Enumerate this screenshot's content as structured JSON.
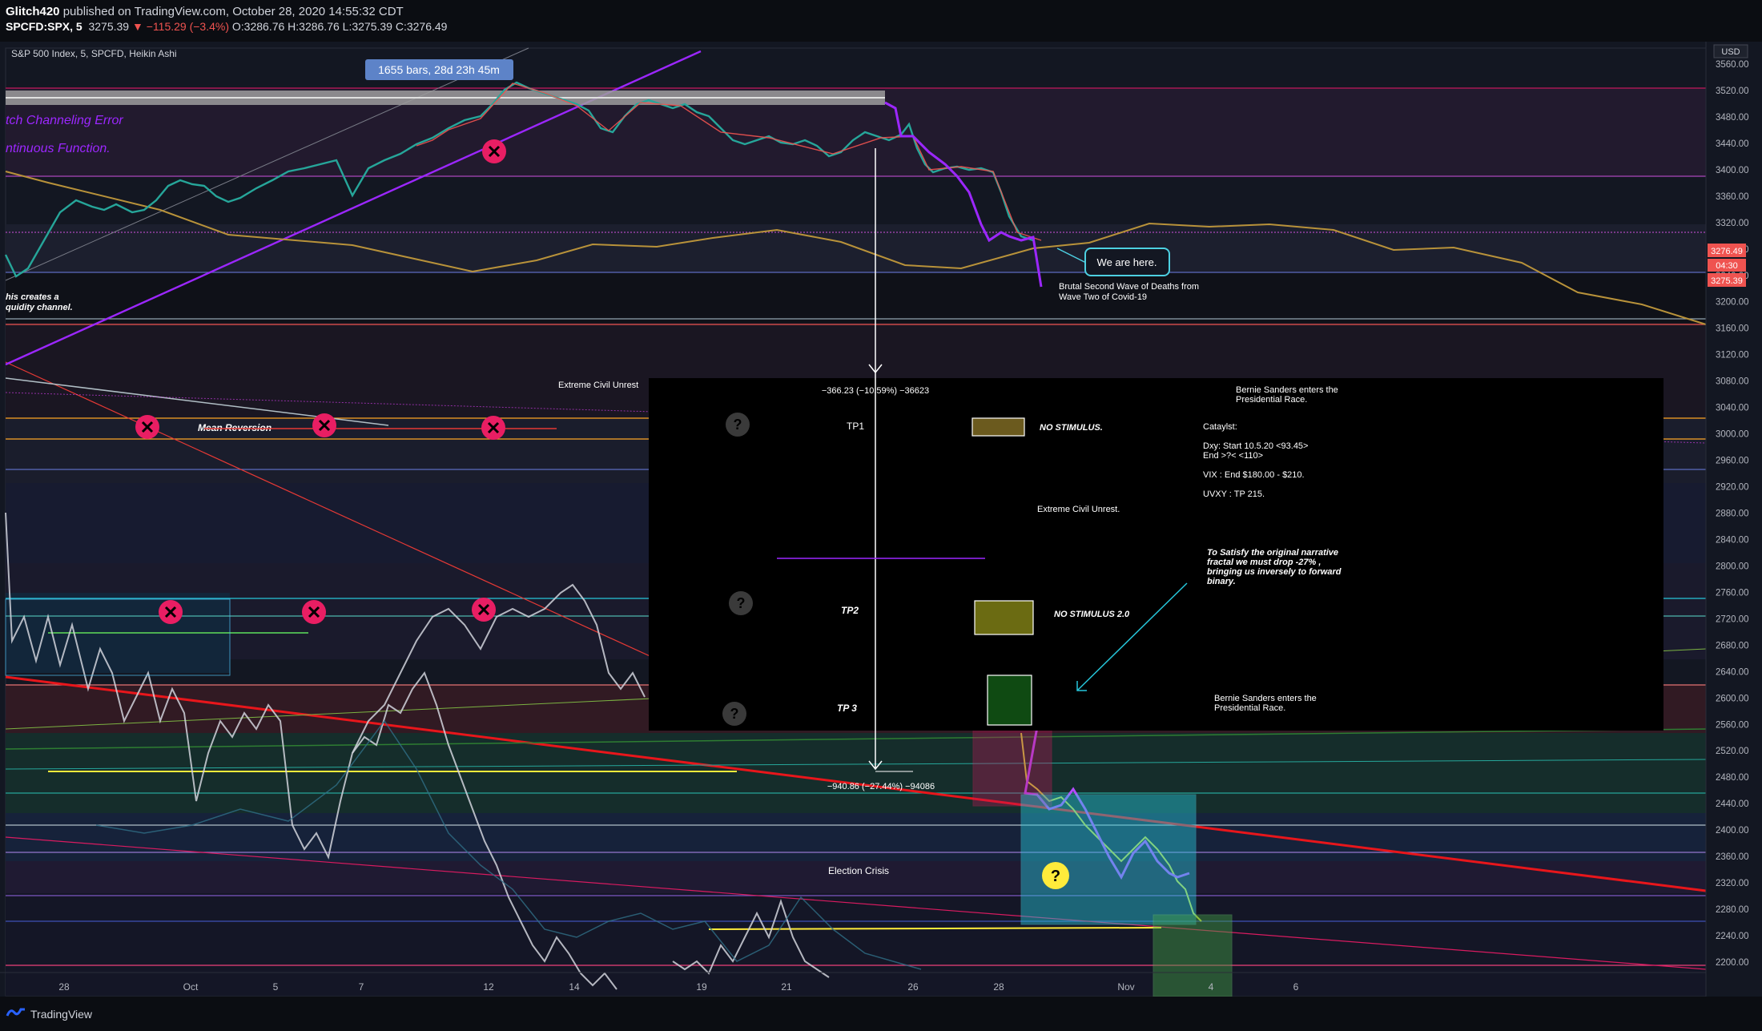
{
  "header": {
    "author": "Glitch420",
    "published_text": "published on TradingView.com, October 28, 2020 14:55:32 CDT",
    "symbol": "SPCFD:SPX, 5",
    "last": "3275.39",
    "change": "▼ −115.29 (−3.4%)",
    "ohlc": "O:3286.76 H:3286.76 L:3275.39 C:3276.49"
  },
  "chart": {
    "legend_title": "S&P 500 Index, 5, SPCFD, Heikin Ashi",
    "bars_label": "1655 bars, 28d 23h 45m",
    "currency": "USD",
    "price_tag_top": "3276.49",
    "price_tag_time": "04:30",
    "price_tag_low": "3275.39"
  },
  "annotations": {
    "glitch_error": "tch Channeling Error",
    "continuous_function": "ntinuous Function.",
    "liquidity_1": "his creates a",
    "liquidity_2": "quidity channel.",
    "mean_reversion": "Mean Reversion",
    "we_are_here": "We are here.",
    "second_wave_1": "Brutal Second Wave of Deaths from",
    "second_wave_2": "Wave Two of Covid-19",
    "civil_unrest_left": "Extreme Civil Unrest",
    "measure_1": "−366.23 (−10.59%) −36623",
    "measure_2": "−940.86 (−27.44%) −94086",
    "tp1": "TP1",
    "tp2": "TP2",
    "tp3": "TP 3",
    "no_stimulus": "NO STIMULUS.",
    "no_stimulus_2": "NO STIMULUS 2.0",
    "civil_unrest_box": "Extreme Civil Unrest.",
    "bernie_top_1": "Bernie Sanders enters the",
    "bernie_top_2": "Presidential Race.",
    "catalyst": "Cataylst:",
    "dxy_1": "Dxy: Start 10.5.20 <93.45>",
    "dxy_2": "End >?< <110>",
    "vix": "VIX : End $180.00 - $210.",
    "uvxy": "UVXY : TP 215.",
    "satisfy_1": "To Satisfy the original narrative",
    "satisfy_2": "fractal we must drop -27% ,",
    "satisfy_3": "bringing us inversely to forward",
    "satisfy_4": "binary.",
    "bernie_bottom_1": "Bernie Sanders enters the",
    "bernie_bottom_2": "Presidential Race.",
    "election_crisis": "Election Crisis",
    "question": "?"
  },
  "footer": {
    "brand": "TradingView"
  },
  "colors": {
    "background": "#131722",
    "purple_line": "#9c27ff",
    "red_trend": "#e8161b",
    "gold_line": "#b8923a",
    "x_marker": "#e91e63",
    "question_yellow": "#ffeb3b"
  },
  "chart_data": {
    "type": "line",
    "title": "S&P 500 Index, 5, SPCFD, Heikin Ashi",
    "xlabel": "",
    "ylabel": "",
    "y_unit": "USD",
    "ylim": [
      2170,
      3580
    ],
    "y_ticks": [
      3560,
      3520,
      3480,
      3440,
      3400,
      3360,
      3320,
      3280,
      3240,
      3200,
      3160,
      3120,
      3080,
      3040,
      3000,
      2960,
      2920,
      2880,
      2840,
      2800,
      2760,
      2720,
      2680,
      2640,
      2600,
      2560,
      2520,
      2480,
      2440,
      2400,
      2360,
      2320,
      2280,
      2240,
      2200
    ],
    "x_tick_labels": [
      "28",
      "Oct",
      "5",
      "7",
      "12",
      "14",
      "19",
      "21",
      "26",
      "28",
      "Nov",
      "4",
      "6"
    ],
    "series": [
      {
        "name": "",
        "x": [
          "Sep 28",
          "Oct 1",
          "Oct 5",
          "Oct 7",
          "Oct 9",
          "Oct 12",
          "Oct 13",
          "Oct 14",
          "Oct 16",
          "Oct 19",
          "Oct 21",
          "Oct 23",
          "Oct 26",
          "Oct 27",
          "Oct 28"
        ],
        "y": [
          3240,
          3350,
          3370,
          3380,
          3440,
          3510,
          3540,
          3500,
          3480,
          3450,
          3440,
          3460,
          3400,
          3390,
          3276
        ]
      }
    ]
  }
}
